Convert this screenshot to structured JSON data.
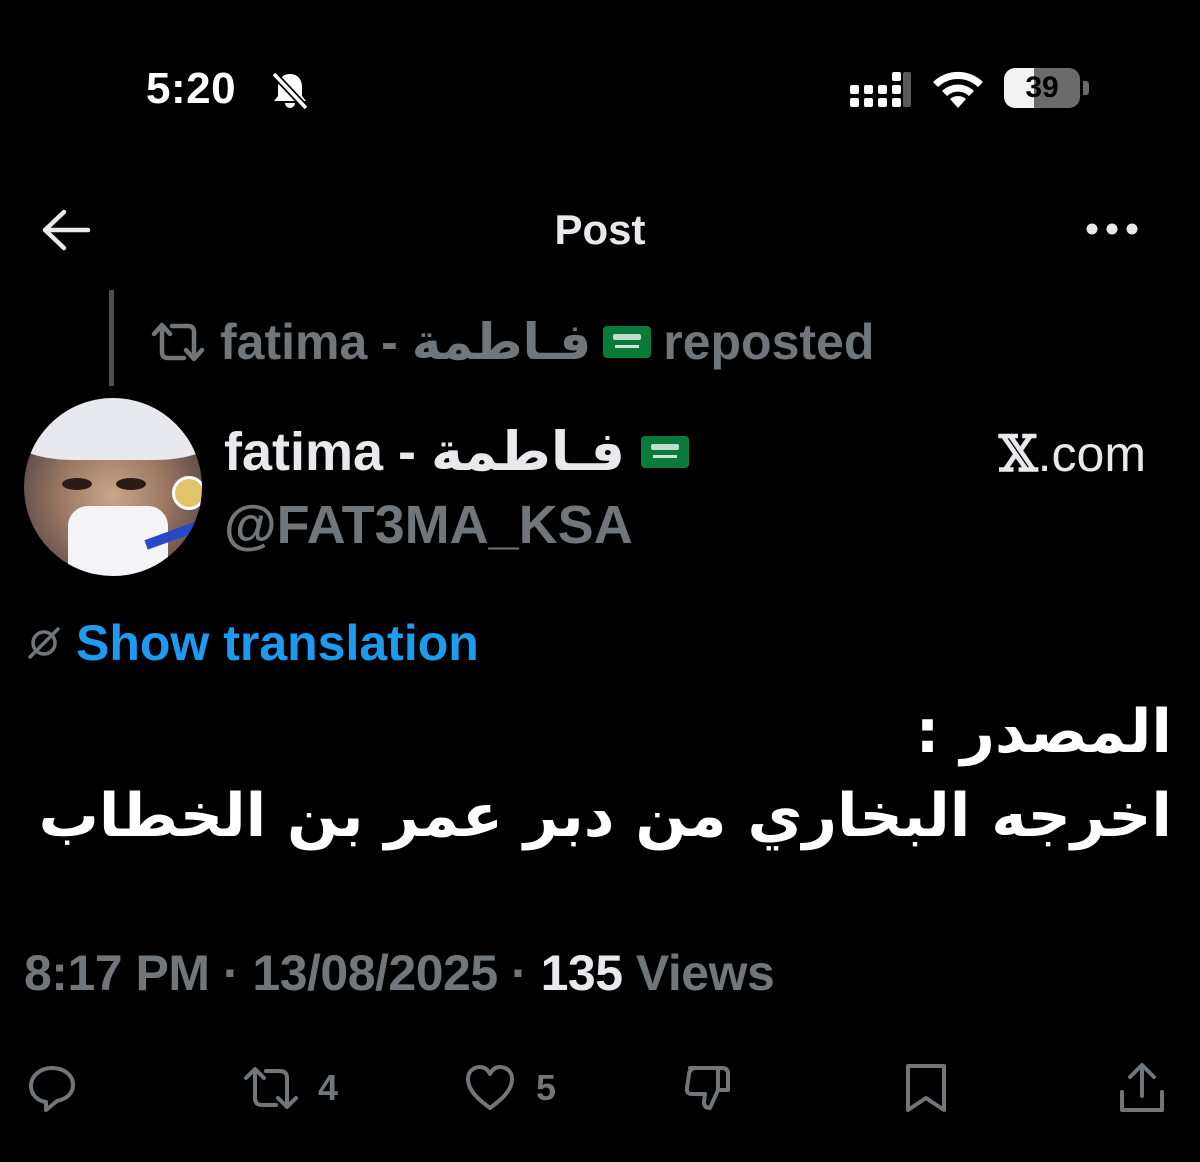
{
  "status_bar": {
    "time": "5:20",
    "battery_level": "39",
    "battery_fraction": 0.39
  },
  "header": {
    "title": "Post"
  },
  "repost": {
    "name_latin": "fatima - ",
    "name_arabic": "فـاطمة",
    "label": "reposted"
  },
  "author": {
    "name_latin": "fatima - ",
    "name_arabic": "فـاطمة",
    "handle": "@FAT3MA_KSA",
    "source_x": "𝕏",
    "source_domain": ".com"
  },
  "translation": {
    "label": "Show translation"
  },
  "tweet": {
    "line1": "المصدر :",
    "line2": "اخرجه البخاري من دبر عمر بن الخطاب"
  },
  "meta": {
    "time": "8:17 PM",
    "separator": " · ",
    "date": "13/08/2025",
    "views_count": "135",
    "views_label": " Views"
  },
  "actions": {
    "reposts": "4",
    "likes": "5"
  },
  "icons": [
    "bell-off-icon",
    "signal-icon",
    "wifi-icon",
    "back-arrow-icon",
    "more-icon",
    "repost-icon",
    "flag-icon",
    "translate-icon",
    "reply-icon",
    "like-icon",
    "dislike-icon",
    "bookmark-icon",
    "share-icon"
  ],
  "colors": {
    "background": "#000000",
    "text_primary": "#e7e9ea",
    "text_secondary": "#71767b",
    "link": "#1d9bf0"
  }
}
